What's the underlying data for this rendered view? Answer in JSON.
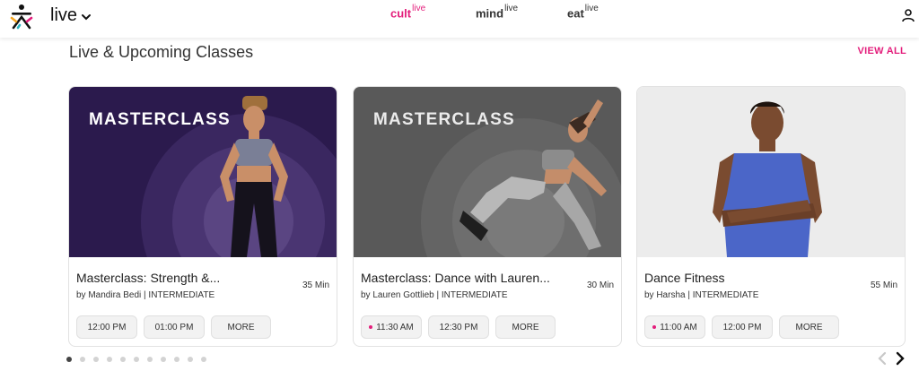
{
  "header": {
    "brand": "live",
    "nav": [
      {
        "name": "cult",
        "sup": "live",
        "active": true
      },
      {
        "name": "mind",
        "sup": "live",
        "active": false
      },
      {
        "name": "eat",
        "sup": "live",
        "active": false
      }
    ],
    "icons": [
      "cult-logo-icon",
      "chevron-down-icon",
      "user-icon"
    ]
  },
  "section": {
    "title": "Live & Upcoming Classes",
    "view_all": "VIEW ALL"
  },
  "cards": [
    {
      "thumb_label": "MASTERCLASS",
      "title": "Masterclass: Strength &...",
      "subtitle": "by Mandira Bedi | INTERMEDIATE",
      "duration": "35 Min",
      "slots": [
        {
          "time": "12:00 PM",
          "live": false
        },
        {
          "time": "01:00 PM",
          "live": false
        }
      ],
      "more": "MORE"
    },
    {
      "thumb_label": "MASTERCLASS",
      "title": "Masterclass: Dance with Lauren...",
      "subtitle": "by Lauren Gottlieb | INTERMEDIATE",
      "duration": "30 Min",
      "slots": [
        {
          "time": "11:30 AM",
          "live": true
        },
        {
          "time": "12:30 PM",
          "live": false
        }
      ],
      "more": "MORE"
    },
    {
      "thumb_label": "",
      "title": "Dance Fitness",
      "subtitle": "by Harsha | INTERMEDIATE",
      "duration": "55 Min",
      "slots": [
        {
          "time": "11:00 AM",
          "live": true
        },
        {
          "time": "12:00 PM",
          "live": false
        }
      ],
      "more": "MORE"
    }
  ],
  "pagination": {
    "total": 11,
    "active": 1
  },
  "colors": {
    "accent": "#e31d7b",
    "card1_bg": "#2b1a4d",
    "card2_bg": "#5a5a5a",
    "card3_bg": "#ececec"
  }
}
